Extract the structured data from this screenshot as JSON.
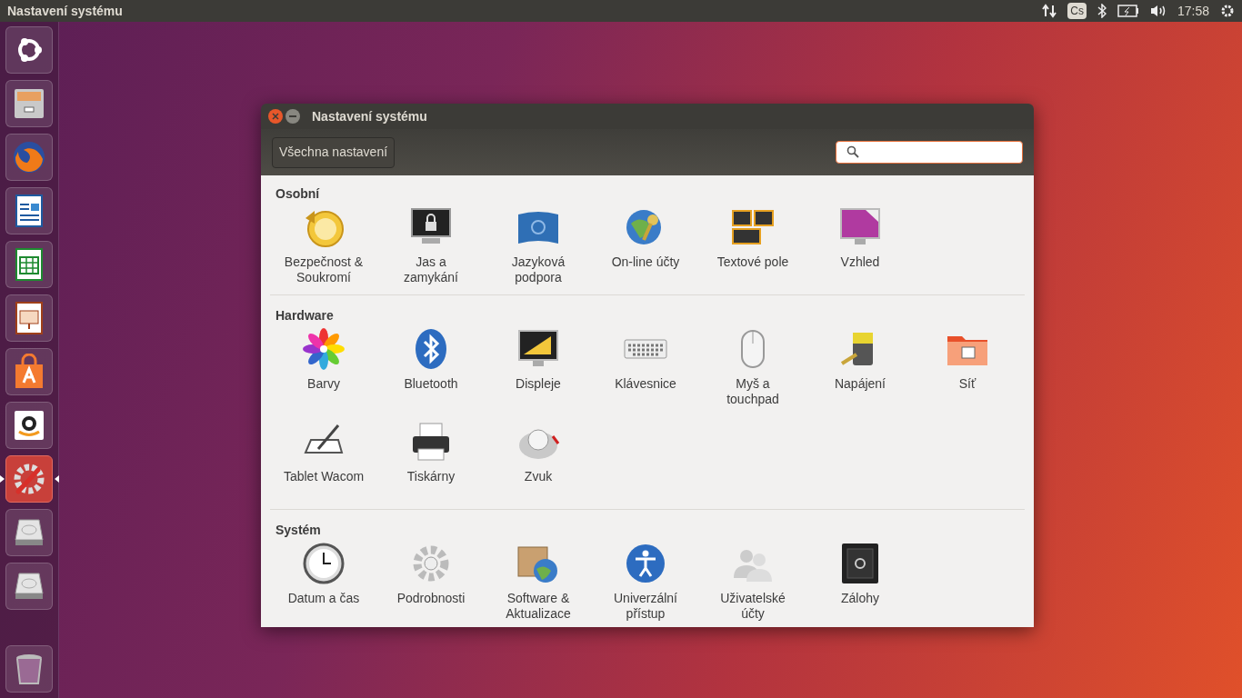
{
  "top_bar": {
    "title": "Nastavení systému",
    "keyboard_layout": "Cs",
    "time": "17:58"
  },
  "launcher": [
    {
      "kind": "ubuntu",
      "selected": false
    },
    {
      "kind": "files",
      "selected": false
    },
    {
      "kind": "browser",
      "selected": false
    },
    {
      "kind": "writer",
      "selected": false
    },
    {
      "kind": "calc",
      "selected": false
    },
    {
      "kind": "impress",
      "selected": false
    },
    {
      "kind": "software",
      "selected": false
    },
    {
      "kind": "amazon",
      "selected": false
    },
    {
      "kind": "settings",
      "selected": true
    },
    {
      "kind": "drive",
      "selected": false
    },
    {
      "kind": "drive",
      "selected": false
    },
    {
      "kind": "trash",
      "selected": false
    }
  ],
  "window": {
    "title": "Nastavení systému",
    "all_settings_button": "Všechna nastavení"
  },
  "sections": [
    {
      "title": "Osobní",
      "items": [
        {
          "kind": "backup",
          "label": "Bezpečnost &\nSoukromí"
        },
        {
          "kind": "lock",
          "label": "Jas a\nzamykání"
        },
        {
          "kind": "language",
          "label": "Jazyková\npodpora"
        },
        {
          "kind": "accounts",
          "label": "On-line účty"
        },
        {
          "kind": "text",
          "label": "Textové pole"
        },
        {
          "kind": "appearance",
          "label": "Vzhled"
        }
      ]
    },
    {
      "title": "Hardware",
      "items": [
        {
          "kind": "colors",
          "label": "Barvy"
        },
        {
          "kind": "bluetooth",
          "label": "Bluetooth"
        },
        {
          "kind": "display",
          "label": "Displeje"
        },
        {
          "kind": "keyboard",
          "label": "Klávesnice"
        },
        {
          "kind": "mouse",
          "label": "Myš a\ntouchpad"
        },
        {
          "kind": "power",
          "label": "Napájení"
        },
        {
          "kind": "network",
          "label": "Síť"
        },
        {
          "kind": "tablet",
          "label": "Tablet Wacom"
        },
        {
          "kind": "printer",
          "label": "Tiskárny"
        },
        {
          "kind": "sound",
          "label": "Zvuk"
        }
      ]
    },
    {
      "title": "Systém",
      "items": [
        {
          "kind": "clock",
          "label": "Datum a čas"
        },
        {
          "kind": "details",
          "label": "Podrobnosti"
        },
        {
          "kind": "updates",
          "label": "Software &\nAktualizace"
        },
        {
          "kind": "access",
          "label": "Univerzální\npřístup"
        },
        {
          "kind": "users",
          "label": "Uživatelské\núčty"
        },
        {
          "kind": "safe",
          "label": "Zálohy"
        }
      ]
    }
  ]
}
